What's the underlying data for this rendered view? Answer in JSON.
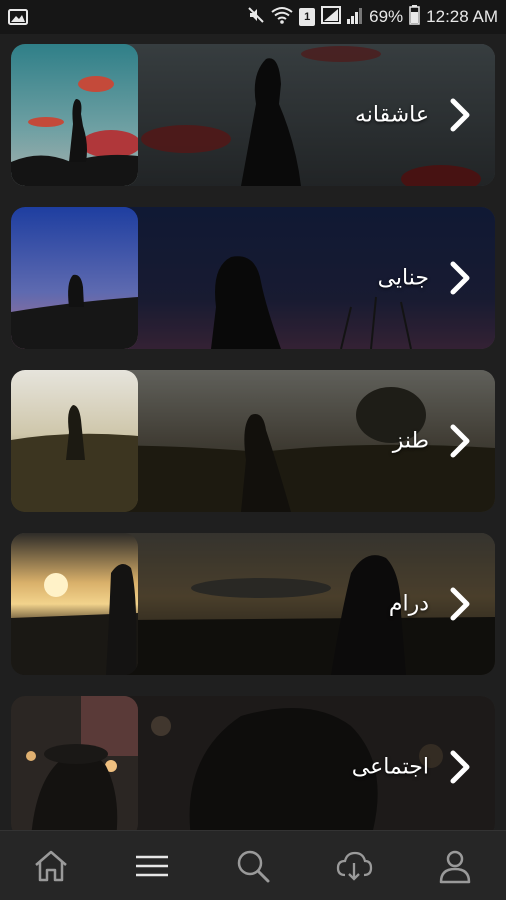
{
  "status_bar": {
    "battery_percent": "69%",
    "time": "12:28 AM",
    "sim_badge": "1"
  },
  "genres": [
    {
      "title": "عاشقانه",
      "icon": "chevron-right-icon"
    },
    {
      "title": "جنایی",
      "icon": "chevron-right-icon"
    },
    {
      "title": "طنز",
      "icon": "chevron-right-icon"
    },
    {
      "title": "درام",
      "icon": "chevron-right-icon"
    },
    {
      "title": "اجتماعی",
      "icon": "chevron-right-icon"
    }
  ],
  "bottom_nav": {
    "items": [
      "home-icon",
      "menu-icon",
      "search-icon",
      "cloud-download-icon",
      "profile-icon"
    ],
    "active": "menu-icon"
  },
  "colors": {
    "background": "#1f1f1f",
    "nav_background": "#262626",
    "icon": "#9a9a9a"
  }
}
